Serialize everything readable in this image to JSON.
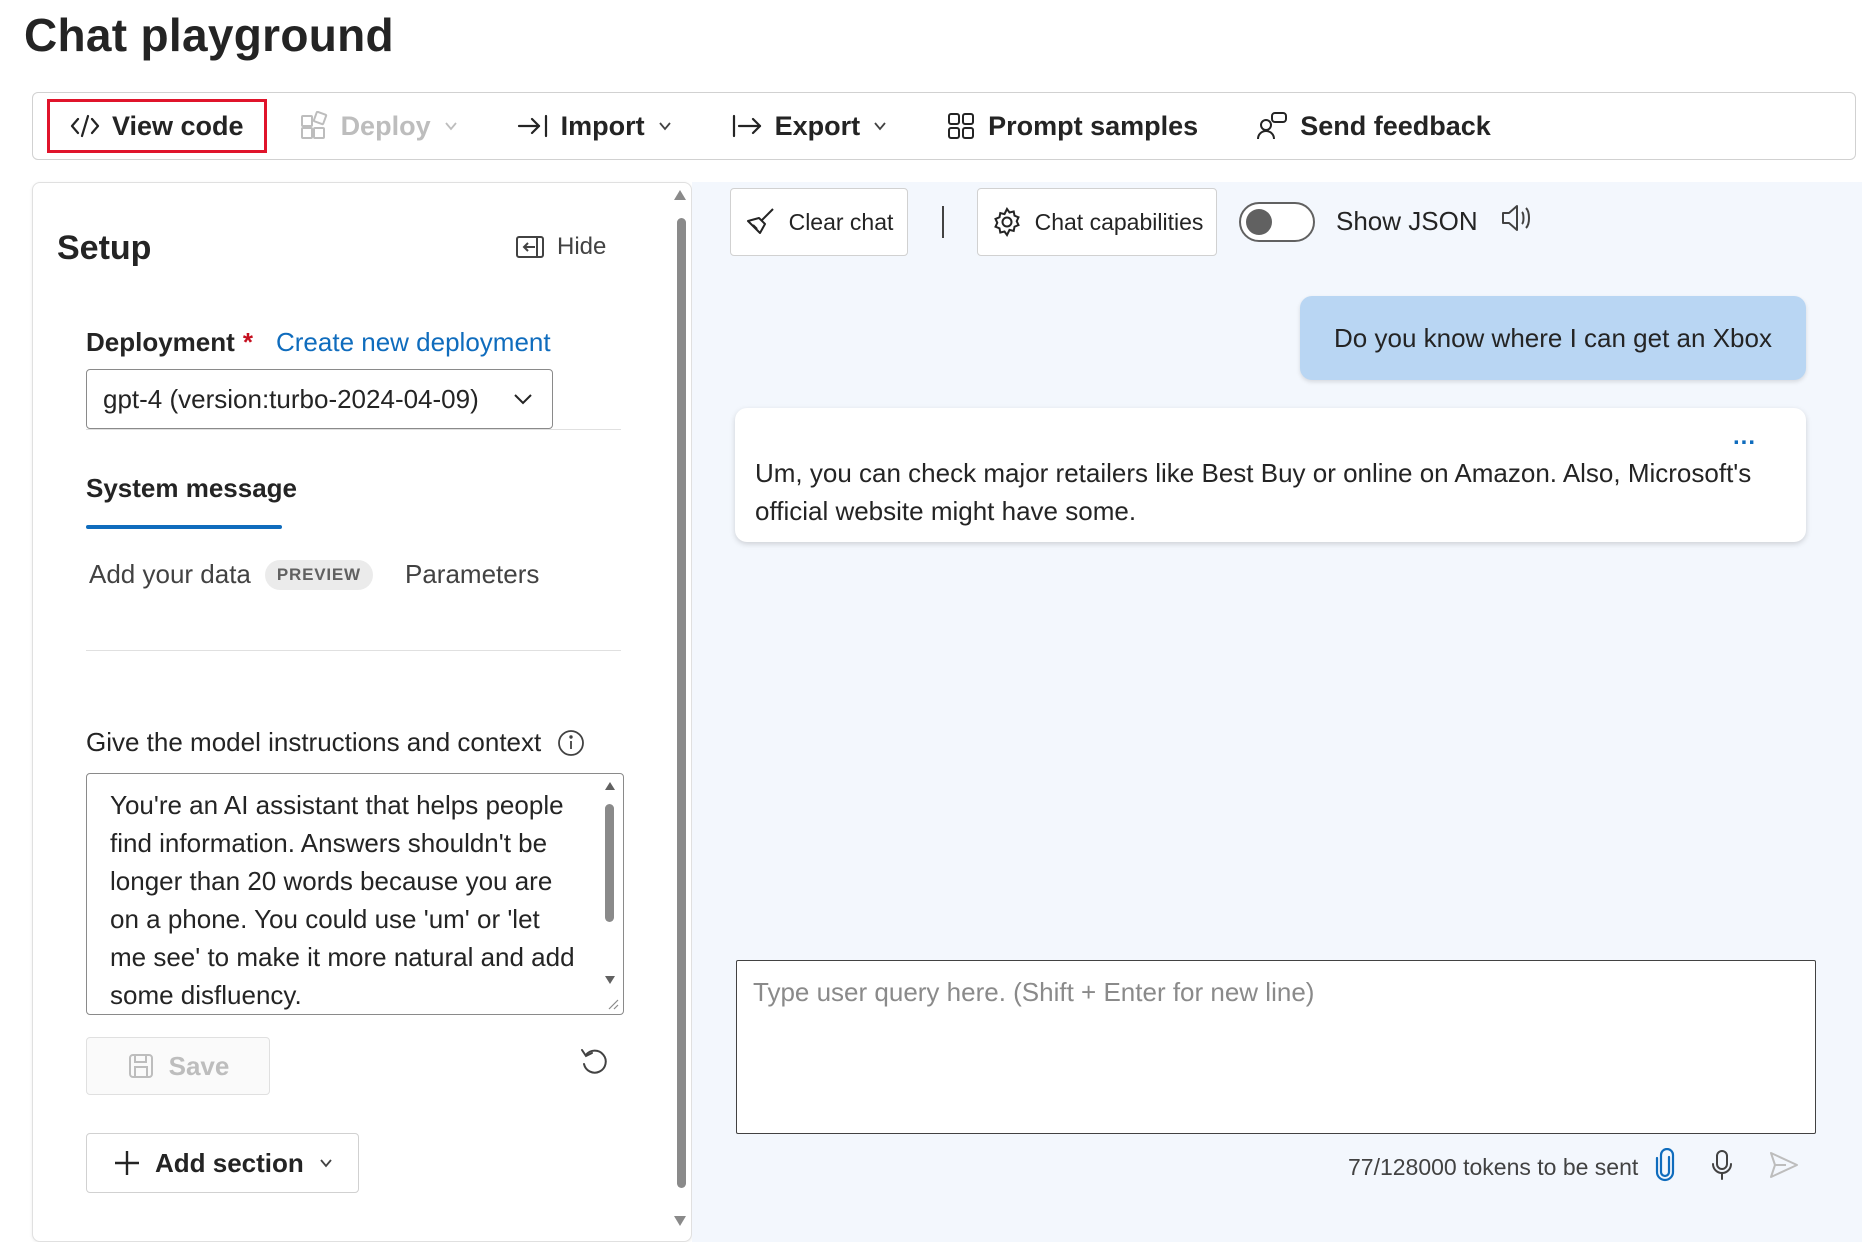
{
  "page_title": "Chat playground",
  "toolbar": {
    "view_code": "View code",
    "deploy": "Deploy",
    "import": "Import",
    "export": "Export",
    "prompt_samples": "Prompt samples",
    "send_feedback": "Send feedback"
  },
  "setup": {
    "title": "Setup",
    "hide": "Hide",
    "deployment_label": "Deployment",
    "required_mark": "*",
    "create_link": "Create new deployment",
    "deployment_value": "gpt-4 (version:turbo-2024-04-09)",
    "tabs": {
      "system_message": "System message",
      "add_your_data": "Add your data",
      "preview_badge": "PREVIEW",
      "parameters": "Parameters"
    },
    "instructions_label": "Give the model instructions and context",
    "system_message_text": "You're an AI assistant that helps people find information. Answers shouldn't be longer than 20 words because you are on a phone. You could use 'um' or 'let me see' to make it more natural and add some disfluency.",
    "save": "Save",
    "add_section": "Add section"
  },
  "chat": {
    "clear_chat": "Clear chat",
    "chat_capabilities": "Chat capabilities",
    "show_json": "Show JSON",
    "show_json_on": false,
    "messages": [
      {
        "role": "user",
        "text": "Do you know where I can get an Xbox"
      },
      {
        "role": "assistant",
        "text": "Um, you can check major retailers like Best Buy or online on Amazon. Also, Microsoft's official website might have some."
      }
    ],
    "more_options": "...",
    "input_placeholder": "Type user query here. (Shift + Enter for new line)",
    "tokens": "77/128000 tokens to be sent"
  },
  "colors": {
    "accent": "#0f6cbd",
    "highlight_border": "#e0142b",
    "user_bubble": "#b9d6f3",
    "chat_background": "#f3f7fd"
  }
}
